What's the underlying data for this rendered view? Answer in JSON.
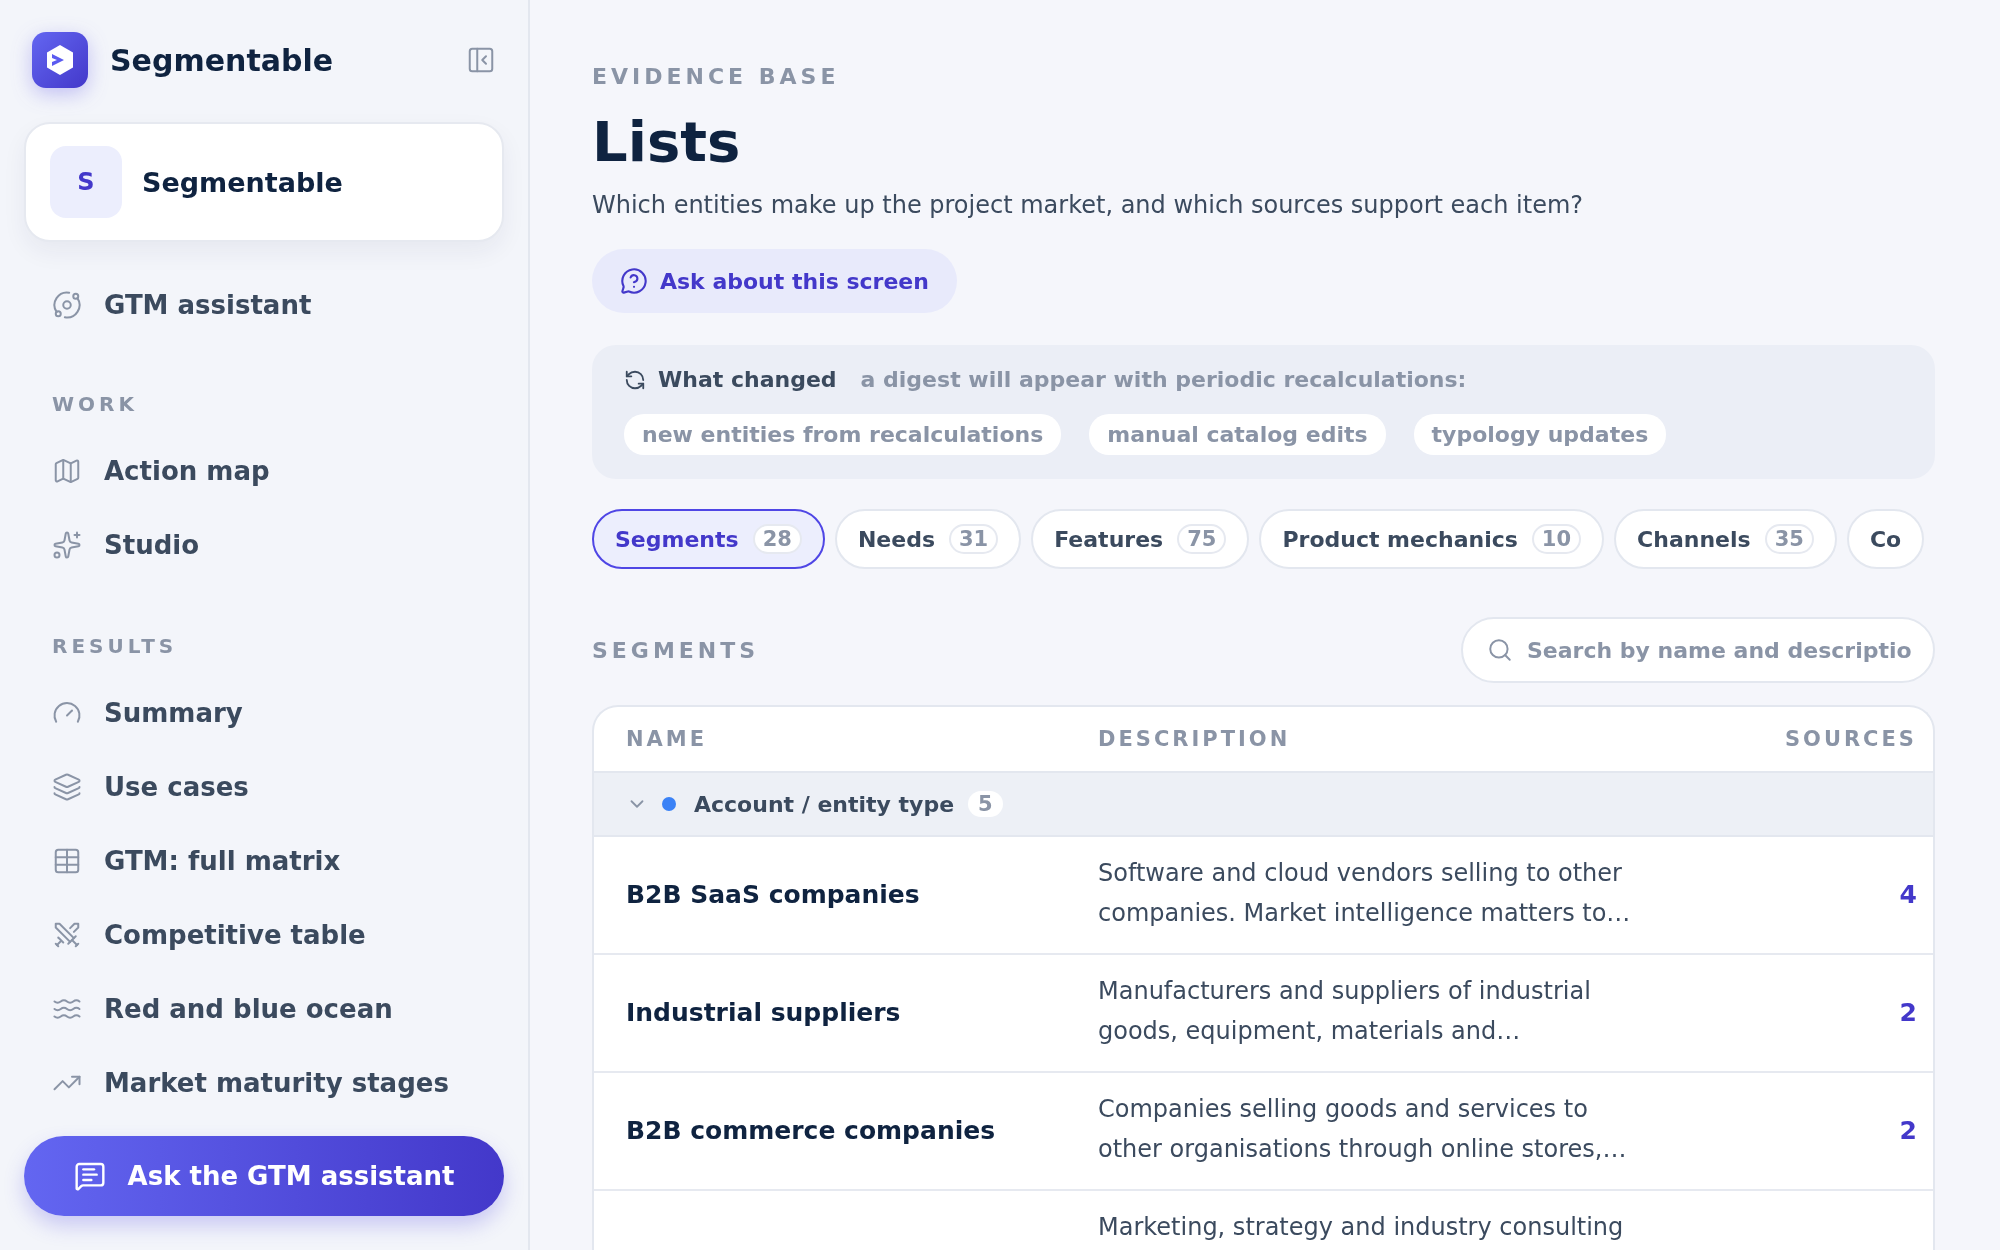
{
  "sidebar": {
    "brand": "Segmentable",
    "project": {
      "initial": "S",
      "name": "Segmentable"
    },
    "assistant_item": {
      "label": "GTM assistant"
    },
    "sections": [
      {
        "heading": "WORK",
        "items": [
          {
            "label": "Action map"
          },
          {
            "label": "Studio"
          }
        ]
      },
      {
        "heading": "RESULTS",
        "items": [
          {
            "label": "Summary"
          },
          {
            "label": "Use cases"
          },
          {
            "label": "GTM: full matrix"
          },
          {
            "label": "Competitive table"
          },
          {
            "label": "Red and blue ocean"
          },
          {
            "label": "Market maturity stages"
          }
        ]
      }
    ],
    "ask_button": "Ask the GTM assistant"
  },
  "header": {
    "eyebrow": "EVIDENCE BASE",
    "title": "Lists",
    "subtitle": "Which entities make up the project market, and which sources support each item?",
    "ask_button": "Ask about this screen"
  },
  "changes": {
    "title": "What changed",
    "note": "a digest will appear with periodic recalculations:",
    "tags": [
      "new entities from recalculations",
      "manual catalog edits",
      "typology updates"
    ]
  },
  "tabs": [
    {
      "label": "Segments",
      "count": "28",
      "selected": true
    },
    {
      "label": "Needs",
      "count": "31",
      "selected": false
    },
    {
      "label": "Features",
      "count": "75",
      "selected": false
    },
    {
      "label": "Product mechanics",
      "count": "10",
      "selected": false
    },
    {
      "label": "Channels",
      "count": "35",
      "selected": false
    },
    {
      "label": "Co",
      "selected": false
    }
  ],
  "list": {
    "heading": "SEGMENTS",
    "search": {
      "placeholder": "Search by name and descriptio"
    },
    "columns": [
      "NAME",
      "DESCRIPTION",
      "SOURCES"
    ],
    "groups": [
      {
        "label": "Account / entity type",
        "count": "5",
        "color": "#3b82f6",
        "expanded": true,
        "rows": [
          {
            "name": "B2B SaaS companies",
            "description": "Software and cloud vendors selling to other companies. Market intelligence matters to…",
            "sources": "4"
          },
          {
            "name": "Industrial suppliers",
            "description": "Manufacturers and suppliers of industrial goods, equipment, materials and…",
            "sources": "2"
          },
          {
            "name": "B2B commerce companies",
            "description": "Companies selling goods and services to other organisations through online stores,…",
            "sources": "2"
          },
          {
            "description": "Marketing, strategy and industry consulting"
          }
        ]
      }
    ]
  }
}
